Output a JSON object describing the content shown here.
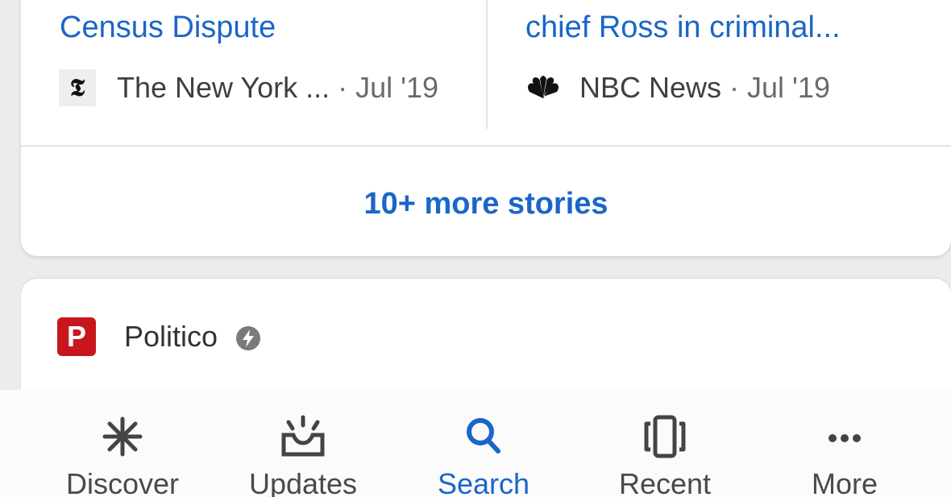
{
  "stories": [
    {
      "title": "Census Dispute",
      "source": "The New York ...",
      "date": "· Jul '19",
      "source_icon": "nyt-logo-icon"
    },
    {
      "title": "chief Ross in criminal...",
      "source": "NBC News",
      "date": "· Jul '19",
      "source_icon": "nbc-peacock-icon"
    }
  ],
  "more_stories_label": "10+ more stories",
  "next_card": {
    "publisher": "Politico",
    "publisher_logo_letter": "P",
    "badge_icon": "amp-lightning-icon"
  },
  "bottom_nav": {
    "active": "Search",
    "items": [
      {
        "label": "Discover",
        "icon": "asterisk-icon"
      },
      {
        "label": "Updates",
        "icon": "inbox-updates-icon"
      },
      {
        "label": "Search",
        "icon": "search-icon"
      },
      {
        "label": "Recent",
        "icon": "recent-cards-icon"
      },
      {
        "label": "More",
        "icon": "more-dots-icon"
      }
    ]
  },
  "colors": {
    "link": "#1a66c9",
    "politico_red": "#c8161d",
    "nav_inactive": "#4a4a4a"
  }
}
